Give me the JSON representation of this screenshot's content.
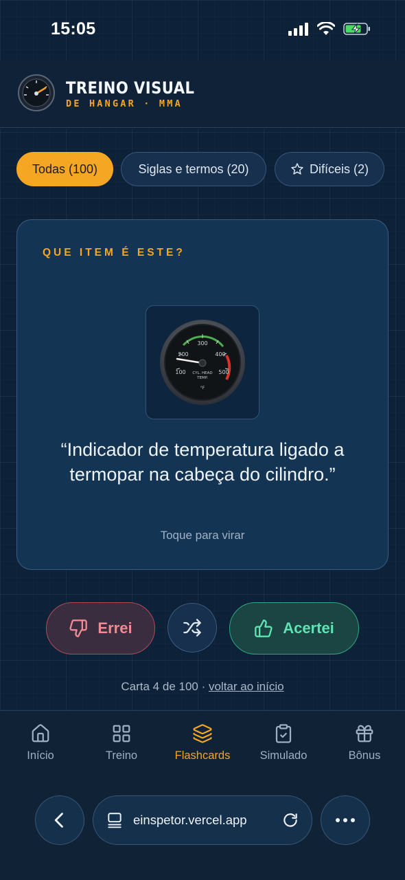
{
  "status_bar": {
    "time": "15:05"
  },
  "brand": {
    "title": "TREINO VISUAL",
    "subtitle": "DE HANGAR · MMA"
  },
  "filters": [
    {
      "label": "Todas (100)",
      "active": true
    },
    {
      "label": "Siglas e termos (20)",
      "active": false
    },
    {
      "label": "Difíceis (2)",
      "active": false,
      "icon": "star-icon"
    }
  ],
  "card": {
    "label": "QUE ITEM É ESTE?",
    "quote": "“Indicador de temperatura ligado a termopar na cabeça do cilindro.”",
    "hint": "Toque para virar",
    "gauge": {
      "ticks": [
        "100",
        "200",
        "300",
        "400",
        "500"
      ],
      "caption_line1": "CYL. HEAD",
      "caption_line2": "TEMP.",
      "unit": "°F"
    }
  },
  "actions": {
    "wrong_label": "Errei",
    "right_label": "Acertei",
    "wrong_icon": "thumbs-down-icon",
    "shuffle_icon": "shuffle-icon",
    "right_icon": "thumbs-up-icon"
  },
  "progress": {
    "text": "Carta 4 de 100 · ",
    "link": "voltar ao início"
  },
  "nav": [
    {
      "label": "Início",
      "icon": "home-icon",
      "active": false
    },
    {
      "label": "Treino",
      "icon": "grid-icon",
      "active": false
    },
    {
      "label": "Flashcards",
      "icon": "layers-icon",
      "active": true
    },
    {
      "label": "Simulado",
      "icon": "clipboard-check-icon",
      "active": false
    },
    {
      "label": "Bônus",
      "icon": "gift-icon",
      "active": false
    }
  ],
  "browser": {
    "url": "einspetor.vercel.app"
  },
  "colors": {
    "accent": "#f5a623",
    "wrong": "#f08a93",
    "right": "#5fe3b3",
    "background": "#0d2238"
  }
}
